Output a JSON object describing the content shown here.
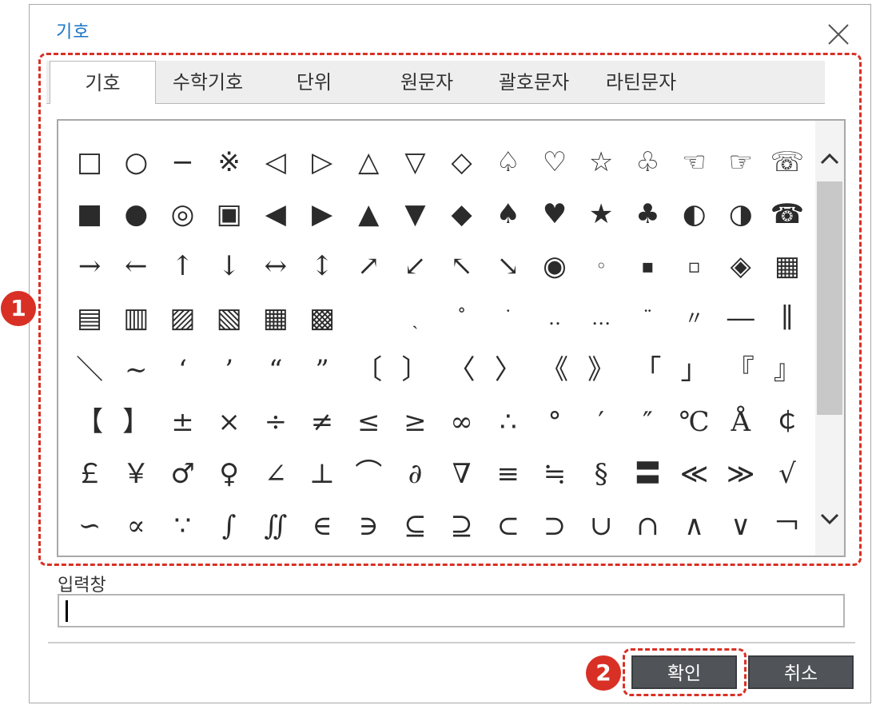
{
  "dialog": {
    "title": "기호",
    "close_icon": "close-icon"
  },
  "tabs": [
    {
      "label": "기호",
      "active": true
    },
    {
      "label": "수학기호",
      "active": false
    },
    {
      "label": "단위",
      "active": false
    },
    {
      "label": "원문자",
      "active": false
    },
    {
      "label": "괄호문자",
      "active": false
    },
    {
      "label": "라틴문자",
      "active": false
    }
  ],
  "symbols": [
    [
      "□",
      "○",
      "−",
      "※",
      "◁",
      "▷",
      "△",
      "▽",
      "◇",
      "♤",
      "♡",
      "☆",
      "♧",
      "☜",
      "☞",
      "☏"
    ],
    [
      "■",
      "●",
      "◎",
      "▣",
      "◀",
      "▶",
      "▲",
      "▼",
      "◆",
      "♠",
      "♥",
      "★",
      "♣",
      "◐",
      "◑",
      "☎"
    ],
    [
      "→",
      "←",
      "↑",
      "↓",
      "↔",
      "↕",
      "↗",
      "↙",
      "↖",
      "↘",
      "◉",
      "◦",
      "▪",
      "▫",
      "◈",
      "▦"
    ],
    [
      "▤",
      "▥",
      "▨",
      "▧",
      "▦",
      "▩",
      "",
      "ˎ",
      "˚",
      "˙",
      "‥",
      "…",
      "¨",
      "〃",
      "―",
      "∥"
    ],
    [
      "＼",
      "∼",
      "‘",
      "’",
      "“",
      "”",
      "〔",
      "〕",
      "〈",
      "〉",
      "《",
      "》",
      "「",
      "」",
      "『",
      "』"
    ],
    [
      "【",
      "】",
      "±",
      "×",
      "÷",
      "≠",
      "≤",
      "≥",
      "∞",
      "∴",
      "°",
      "′",
      "″",
      "℃",
      "Å",
      "￠"
    ],
    [
      "￡",
      "￥",
      "♂",
      "♀",
      "∠",
      "⊥",
      "⌒",
      "∂",
      "∇",
      "≡",
      "≒",
      "§",
      "〓",
      "≪",
      "≫",
      "√"
    ],
    [
      "∽",
      "∝",
      "∵",
      "∫",
      "∬",
      "∈",
      "∋",
      "⊆",
      "⊇",
      "⊂",
      "⊃",
      "∪",
      "∩",
      "∧",
      "∨",
      "￢"
    ]
  ],
  "scrollbar": {
    "up_icon": "chevron-up-icon",
    "down_icon": "chevron-down-icon",
    "position": 0.0
  },
  "input": {
    "label": "입력창",
    "value": ""
  },
  "buttons": {
    "ok": "확인",
    "cancel": "취소"
  },
  "annotations": {
    "badge_1": "1",
    "badge_2": "2"
  },
  "colors": {
    "title": "#1a73c4",
    "annotation": "#d93025",
    "button": "#505458"
  }
}
